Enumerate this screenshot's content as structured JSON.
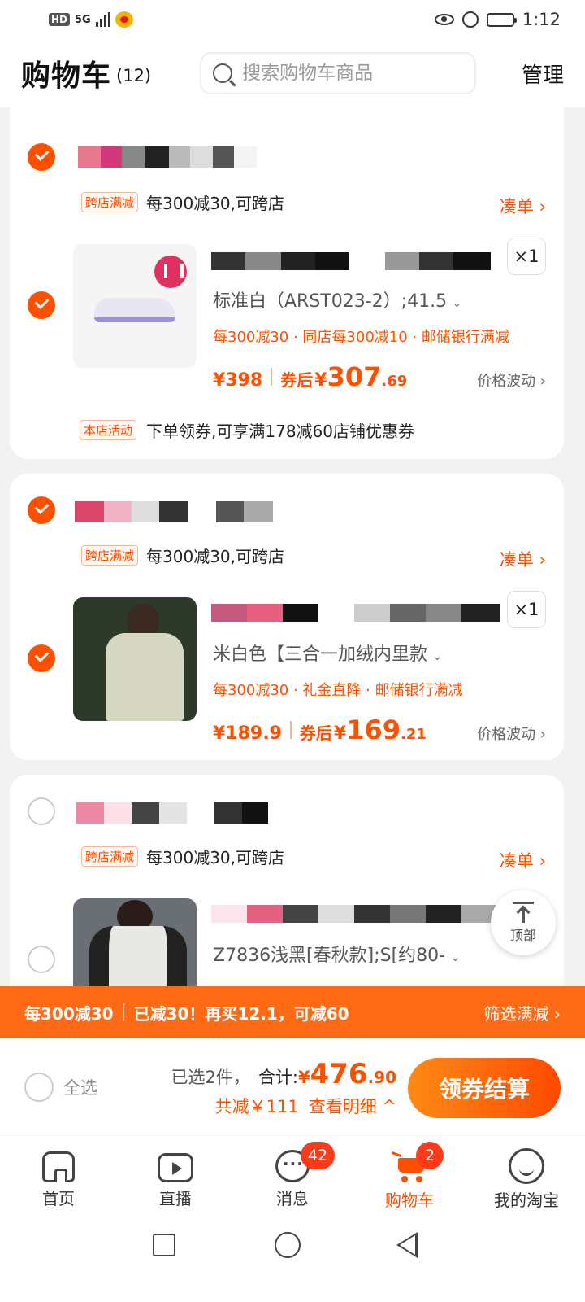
{
  "status_bar": {
    "left_indicators": [
      "HD",
      "5G"
    ],
    "time": "1:12",
    "icons": [
      "eye-icon",
      "alarm-icon",
      "battery-icon"
    ]
  },
  "header": {
    "title": "购物车",
    "count": "(12)",
    "search_placeholder": "搜索购物车商品",
    "manage_label": "管理"
  },
  "cart_groups": [
    {
      "checked": true,
      "promo_tag": "跨店满减",
      "promo_text": "每300减30,可跨店",
      "combine_label": "凑单 ›",
      "item": {
        "checked": true,
        "image": "white-running-shoe",
        "quantity": "×1",
        "sku": "标准白（ARST023-2）;41.5",
        "offers": "每300减30 · 同店每300减10 · 邮储银行满减",
        "price_currency": "¥",
        "price": "398",
        "after_coupon_label": "券后",
        "after_coupon_currency": "¥",
        "after_coupon_int": "307",
        "after_coupon_dec": ".69",
        "fluctuation_label": "价格波动 ›"
      },
      "store_tag": "本店活动",
      "store_text": "下单领券,可享满178减60店铺优惠券"
    },
    {
      "checked": true,
      "promo_tag": "跨店满减",
      "promo_text": "每300减30,可跨店",
      "combine_label": "凑单 ›",
      "item": {
        "checked": true,
        "image": "green-white-jacket",
        "quantity": "×1",
        "sku": "米白色【三合一加绒内里款",
        "offers": "每300减30 · 礼金直降 · 邮储银行满减",
        "price_currency": "¥",
        "price": "189.9",
        "after_coupon_label": "券后",
        "after_coupon_currency": "¥",
        "after_coupon_int": "169",
        "after_coupon_dec": ".21",
        "fluctuation_label": "价格波动 ›"
      }
    },
    {
      "checked": false,
      "promo_tag": "跨店满减",
      "promo_text": "每300减30,可跨店",
      "combine_label": "凑单 ›",
      "item": {
        "checked": false,
        "image": "black-white-jacket",
        "sku": "Z7836浅黑[春秋款];S[约80-"
      }
    }
  ],
  "back_to_top": {
    "label": "顶部"
  },
  "promo_bar": {
    "rule": "每300减30",
    "progress": "已减30！再买12.1，可减60",
    "filter_label": "筛选满减 ›"
  },
  "checkout": {
    "select_all_label": "全选",
    "selected_text": "已选2件，",
    "total_label": "合计:",
    "total_currency": "¥",
    "total_int": "476",
    "total_dec": ".90",
    "discount_text": "共减￥111",
    "detail_label": "查看明细 ^",
    "button_label": "领券结算"
  },
  "tab_bar": {
    "tabs": [
      {
        "label": "首页"
      },
      {
        "label": "直播"
      },
      {
        "label": "消息",
        "badge": "42"
      },
      {
        "label": "购物车",
        "badge": "2",
        "active": true
      },
      {
        "label": "我的淘宝"
      }
    ]
  },
  "colors": {
    "accent": "#ff5000",
    "promo_bar": "#ff6a14",
    "badge": "#ff3a1a"
  }
}
